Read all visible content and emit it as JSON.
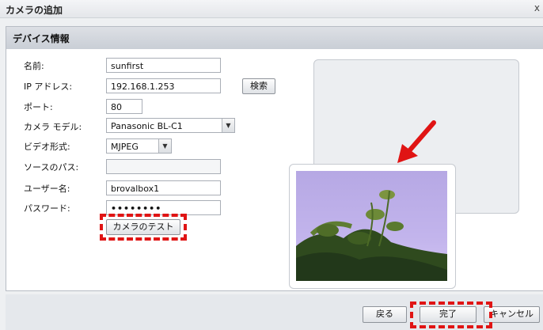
{
  "window": {
    "title": "カメラの追加",
    "close_glyph": "x"
  },
  "section": {
    "title": "デバイス情報"
  },
  "form": {
    "name_label": "名前:",
    "name_value": "sunfirst",
    "ip_label": "IP アドレス:",
    "ip_value": "192.168.1.253",
    "search_button": "検索",
    "port_label": "ポート:",
    "port_value": "80",
    "model_label": "カメラ モデル:",
    "model_value": "Panasonic BL-C1",
    "video_label": "ビデオ形式:",
    "video_value": "MJPEG",
    "source_label": "ソースのパス:",
    "source_value": "",
    "user_label": "ユーザー名:",
    "user_value": "brovalbox1",
    "password_label": "パスワード:",
    "password_value": "••••••••",
    "test_button": "カメラのテスト"
  },
  "footer": {
    "back_button": "戻る",
    "done_button": "完了",
    "cancel_button": "キャンセル"
  },
  "colors": {
    "highlight": "#e01414",
    "accent": "#b7bcc4"
  },
  "icons": {
    "dropdown": "chevron-down-icon",
    "arrow": "red-arrow-icon"
  }
}
